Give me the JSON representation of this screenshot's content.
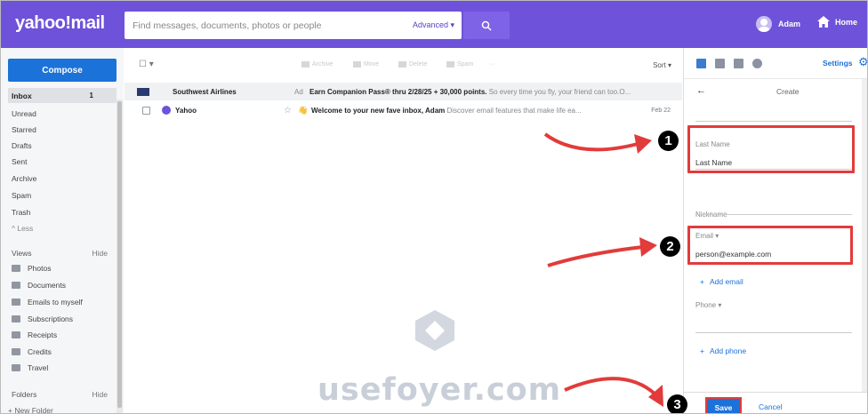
{
  "header": {
    "logo": "yahoo!mail",
    "search_placeholder": "Find messages, documents, photos or people",
    "advanced": "Advanced",
    "user_name": "Adam",
    "home": "Home"
  },
  "sidebar": {
    "compose": "Compose",
    "nav": [
      {
        "label": "Inbox",
        "count": "1"
      },
      {
        "label": "Unread"
      },
      {
        "label": "Starred"
      },
      {
        "label": "Drafts"
      },
      {
        "label": "Sent"
      },
      {
        "label": "Archive"
      },
      {
        "label": "Spam"
      },
      {
        "label": "Trash"
      },
      {
        "label": "^ Less"
      }
    ],
    "views_header": "Views",
    "views_hide": "Hide",
    "views": [
      "Photos",
      "Documents",
      "Emails to myself",
      "Subscriptions",
      "Receipts",
      "Credits",
      "Travel"
    ],
    "folders_header": "Folders",
    "folders_hide": "Hide",
    "new_folder": "+ New Folder"
  },
  "toolbar": {
    "archive": "Archive",
    "move": "Move",
    "delete": "Delete",
    "spam": "Spam",
    "more": "···",
    "sort": "Sort"
  },
  "messages": [
    {
      "sender": "Southwest Airlines",
      "ad_tag": "Ad",
      "subject": "Earn Companion Pass® thru 2/28/25 + 30,000 points.",
      "snippet": "So every time you fly, your friend can too.O..."
    },
    {
      "sender": "Yahoo",
      "subject": "Welcome to your new fave inbox, Adam",
      "snippet": "Discover email features that make life ea...",
      "date": "Feb 22"
    }
  ],
  "panel": {
    "settings": "Settings",
    "create_title": "Create",
    "last_name_label": "Last Name",
    "last_name_value": "Last Name",
    "nickname_label": "Nickname",
    "email_label": "Email",
    "email_value": "person@example.com",
    "add_email": "Add email",
    "phone_label": "Phone",
    "add_phone": "Add phone",
    "save": "Save",
    "cancel": "Cancel"
  },
  "annotations": {
    "badge1": "1",
    "badge2": "2",
    "badge3": "3",
    "watermark": "usefoyer.com",
    "accent": "#e23b3b"
  },
  "colors": {
    "header_purple": "#6e52d9",
    "compose_blue": "#1b72d8"
  }
}
